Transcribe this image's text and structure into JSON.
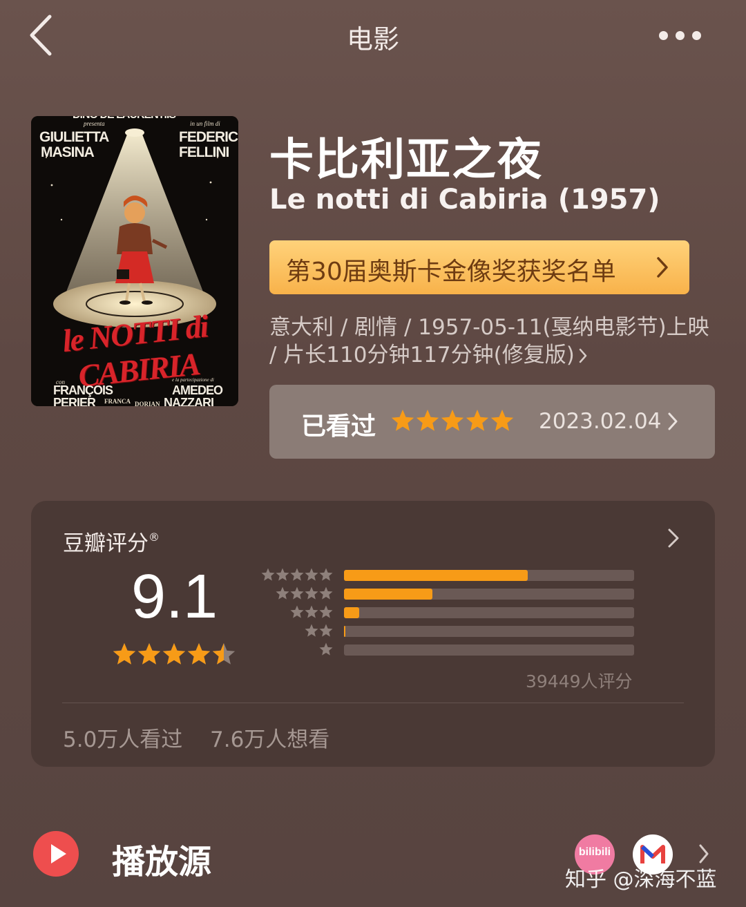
{
  "header": {
    "title": "电影"
  },
  "poster": {
    "top_credit": "DINO DE LAURENTIIS",
    "presents": "presenta",
    "actress": [
      "GIULIETTA",
      "MASINA"
    ],
    "film_by": "in un film di",
    "director": [
      "FEDERICO",
      "FELLINI"
    ],
    "logo": "le NOTTI di CABIRIA",
    "with": "con",
    "bottom_left": [
      "FRANÇOIS",
      "PERIER"
    ],
    "bottom_mid": [
      "FRANCA",
      "DORIAN"
    ],
    "partecipation": "e la partecipazione di",
    "bottom_right": [
      "AMEDEO",
      "NAZZARI"
    ]
  },
  "movie": {
    "title_cn": "卡比利亚之夜",
    "title_original": "Le notti di Cabiria (1957)",
    "award_label": "第30届奥斯卡金像奖获奖名单",
    "meta": "意大利 / 剧情 / 1957-05-11(戛纳电影节)上映 / 片长110分钟117分钟(修复版)"
  },
  "my_rating": {
    "label": "已看过",
    "stars": 5,
    "date": "2023.02.04"
  },
  "rating": {
    "title": "豆瓣评分",
    "registered_mark": "®",
    "score": "9.1",
    "stars": 4.5,
    "distribution": [
      {
        "stars": 5,
        "fraction": 0.633
      },
      {
        "stars": 4,
        "fraction": 0.305
      },
      {
        "stars": 3,
        "fraction": 0.052
      },
      {
        "stars": 2,
        "fraction": 0.004
      },
      {
        "stars": 1,
        "fraction": 0.0
      }
    ],
    "count": "39449人评分",
    "watched": "5.0万人看过",
    "want": "7.6万人想看"
  },
  "play_source": {
    "label": "播放源",
    "sources": [
      {
        "name": "bilibili",
        "icon": "bilibili-icon"
      },
      {
        "name": "mgtv",
        "icon": "mgtv-icon"
      }
    ]
  },
  "watermark": "知乎 @深海不蓝",
  "colors": {
    "background": "#5f4a45",
    "accent_orange": "#f79b17",
    "award_gradient_top": "#ffd27a",
    "award_gradient_bottom": "#f8b24a",
    "play_red": "#ee4e4e",
    "star_gray": "#8e807b"
  }
}
